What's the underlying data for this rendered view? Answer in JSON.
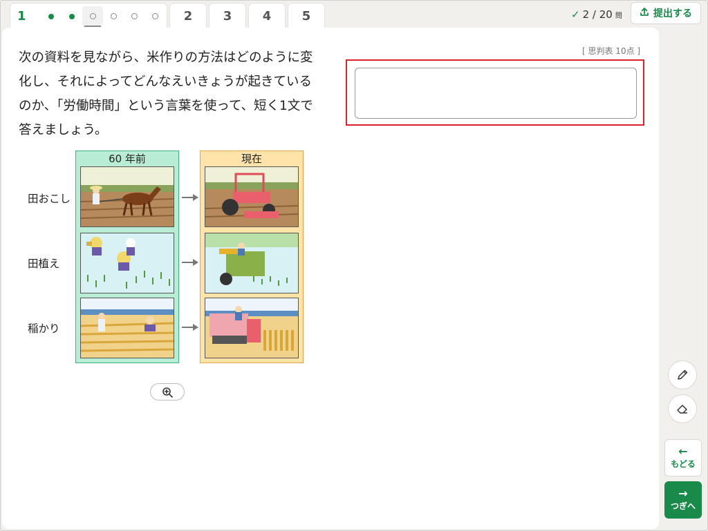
{
  "tabs": {
    "active_number": "1",
    "others": [
      "2",
      "3",
      "4",
      "5"
    ]
  },
  "progress": {
    "check_icon": "check-icon",
    "count": "2 / 20",
    "unit": "問"
  },
  "submit": {
    "label": "提出する",
    "icon": "upload-icon"
  },
  "question": {
    "text": "次の資料を見ながら、米作りの方法はどのように変化し、それによってどんなえいきょうが起きているのか、「労働時間」という言葉を使って、短く1文で答えましょう。",
    "score": "[ 思判表 10点 ]",
    "answer_value": ""
  },
  "figure": {
    "past_header": "60 年前",
    "now_header": "現在",
    "rows": [
      "田おこし",
      "田植え",
      "稲かり"
    ]
  },
  "tools": {
    "pen_icon": "pencil-icon",
    "eraser_icon": "eraser-icon",
    "zoom_icon": "zoom-in-icon"
  },
  "nav": {
    "back_label": "もどる",
    "next_label": "つぎへ"
  },
  "colors": {
    "accent": "#1a8a4a",
    "highlight": "#d9232b"
  }
}
